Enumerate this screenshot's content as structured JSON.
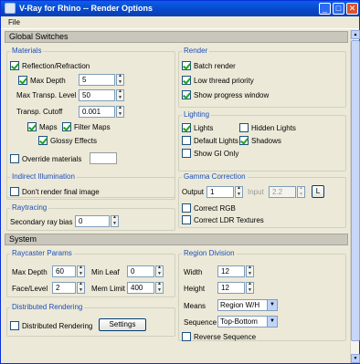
{
  "window": {
    "title": "V-Ray for Rhino -- Render Options",
    "minimize": "_",
    "maximize": "□",
    "close": "✕"
  },
  "menu": {
    "file": "File"
  },
  "global": {
    "header": "Global Switches",
    "materials": {
      "title": "Materials",
      "reflection": "Reflection/Refraction",
      "max_depth_label": "Max Depth",
      "max_depth": "5",
      "max_transp_label": "Max Transp. Level",
      "max_transp": "50",
      "transp_cutoff_label": "Transp. Cutoff",
      "transp_cutoff": "0.001",
      "maps": "Maps",
      "filter_maps": "Filter Maps",
      "glossy": "Glossy Effects",
      "override": "Override materials"
    },
    "render": {
      "title": "Render",
      "batch": "Batch render",
      "low_thread": "Low thread priority",
      "show_progress": "Show progress window"
    },
    "lighting": {
      "title": "Lighting",
      "lights": "Lights",
      "hidden_lights": "Hidden Lights",
      "default_lights": "Default Lights",
      "shadows": "Shadows",
      "show_gi_only": "Show GI Only"
    },
    "indirect": {
      "title": "Indirect Illumination",
      "dont_render": "Don't render final image"
    },
    "gamma": {
      "title": "Gamma Correction",
      "output_label": "Output",
      "output": "1",
      "input_label": "Input",
      "input": "2.2",
      "l_button": "L",
      "correct_rgb": "Correct RGB",
      "correct_ldr": "Correct LDR Textures"
    },
    "raytracing": {
      "title": "Raytracing",
      "bias_label": "Secondary ray bias",
      "bias": "0"
    }
  },
  "system": {
    "header": "System",
    "raycaster": {
      "title": "Raycaster Params",
      "max_depth_label": "Max Depth",
      "max_depth": "60",
      "min_leaf_label": "Min Leaf",
      "min_leaf": "0",
      "face_level_label": "Face/Level",
      "face_level": "2",
      "mem_limit_label": "Mem Limit",
      "mem_limit": "400"
    },
    "region": {
      "title": "Region Division",
      "width_label": "Width",
      "width": "12",
      "height_label": "Height",
      "height": "12",
      "means_label": "Means",
      "means": "Region W/H",
      "sequence_label": "Sequence",
      "sequence": "Top-Bottom",
      "reverse": "Reverse Sequence"
    },
    "distributed": {
      "title": "Distributed Rendering",
      "enable": "Distributed Rendering",
      "settings": "Settings"
    }
  }
}
